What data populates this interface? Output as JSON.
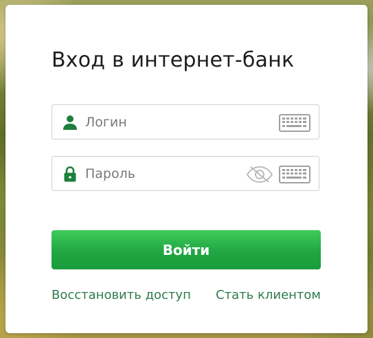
{
  "login_form": {
    "title": "Вход в интернет-банк",
    "login": {
      "placeholder": "Логин",
      "value": "",
      "icon": "user-icon"
    },
    "password": {
      "placeholder": "Пароль",
      "value": "",
      "icon": "lock-icon",
      "visibility_icon": "eye-slash-icon"
    },
    "virtual_keyboard_icon": "keyboard-icon",
    "submit_label": "Войти",
    "links": {
      "restore_access": "Восстановить доступ",
      "become_client": "Стать клиентом"
    }
  },
  "colors": {
    "accent_green": "#21a643",
    "icon_green": "#1e7e3c",
    "link_green": "#2f7a4f",
    "icon_gray": "#a0a0a0"
  }
}
